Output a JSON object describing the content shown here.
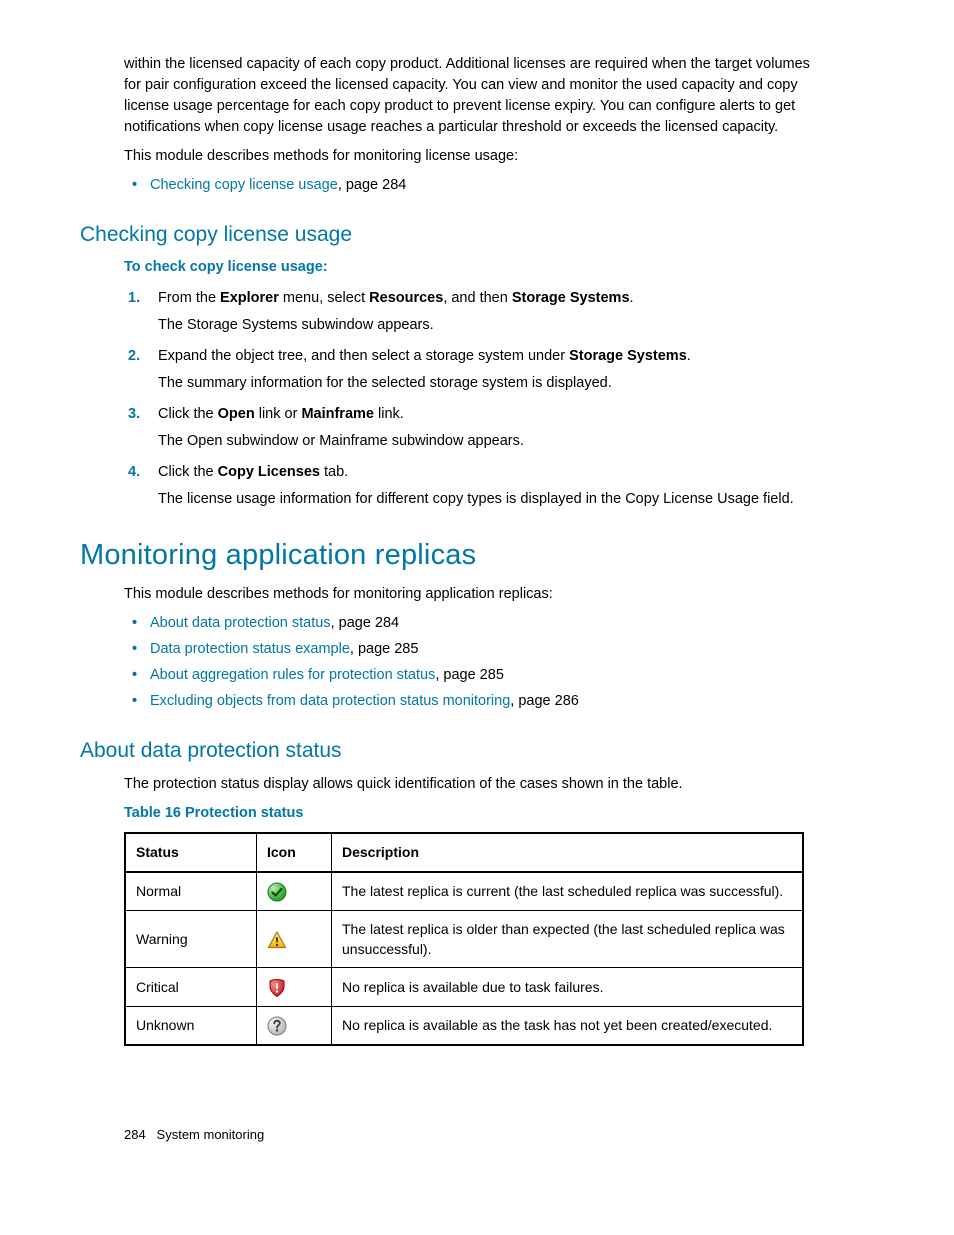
{
  "intro": {
    "p1": "within the licensed capacity of each copy product. Additional licenses are required when the target volumes for pair configuration exceed the licensed capacity. You can view and monitor the used capacity and copy license usage percentage for each copy product to prevent license expiry. You can configure alerts to get notifications when copy license usage reaches a particular threshold or exceeds the licensed capacity.",
    "p2": "This module describes methods for monitoring license usage:",
    "bullet_link": "Checking copy license usage",
    "bullet_page": ", page 284"
  },
  "s1": {
    "heading": "Checking copy license usage",
    "sub": "To check copy license usage:",
    "step1_a": "From the ",
    "step1_b": "Explorer",
    "step1_c": " menu, select ",
    "step1_d": "Resources",
    "step1_e": ", and then ",
    "step1_f": "Storage Systems",
    "step1_g": ".",
    "step1_body": "The Storage Systems subwindow appears.",
    "step2_a": "Expand the object tree, and then select a storage system under ",
    "step2_b": "Storage Systems",
    "step2_c": ".",
    "step2_body": "The summary information for the selected storage system is displayed.",
    "step3_a": "Click the ",
    "step3_b": "Open",
    "step3_c": " link or ",
    "step3_d": "Mainframe",
    "step3_e": " link.",
    "step3_body": "The Open subwindow or Mainframe subwindow appears.",
    "step4_a": "Click the ",
    "step4_b": "Copy Licenses",
    "step4_c": " tab.",
    "step4_body": "The license usage information for different copy types is displayed in the Copy License Usage field."
  },
  "s2": {
    "heading": "Monitoring application replicas",
    "intro": "This module describes methods for monitoring application replicas:",
    "b1_link": "About data protection status",
    "b1_page": ", page 284",
    "b2_link": "Data protection status example",
    "b2_page": ", page 285",
    "b3_link": "About aggregation rules for protection status",
    "b3_page": ", page 285",
    "b4_link": "Excluding objects from data protection status monitoring",
    "b4_page": ", page 286"
  },
  "s3": {
    "heading": "About data protection status",
    "intro": "The protection status display allows quick identification of the cases shown in the table.",
    "table_caption": "Table 16 Protection status",
    "th_status": "Status",
    "th_icon": "Icon",
    "th_desc": "Description",
    "rows": [
      {
        "status": "Normal",
        "desc": "The latest replica is current (the last scheduled replica was successful)."
      },
      {
        "status": "Warning",
        "desc": "The latest replica is older than expected (the last scheduled replica was unsuccessful)."
      },
      {
        "status": "Critical",
        "desc": "No replica is available due to task failures."
      },
      {
        "status": "Unknown",
        "desc": "No replica is available as the task has not yet been created/executed."
      }
    ]
  },
  "footer": {
    "page": "284",
    "section": "System monitoring"
  }
}
